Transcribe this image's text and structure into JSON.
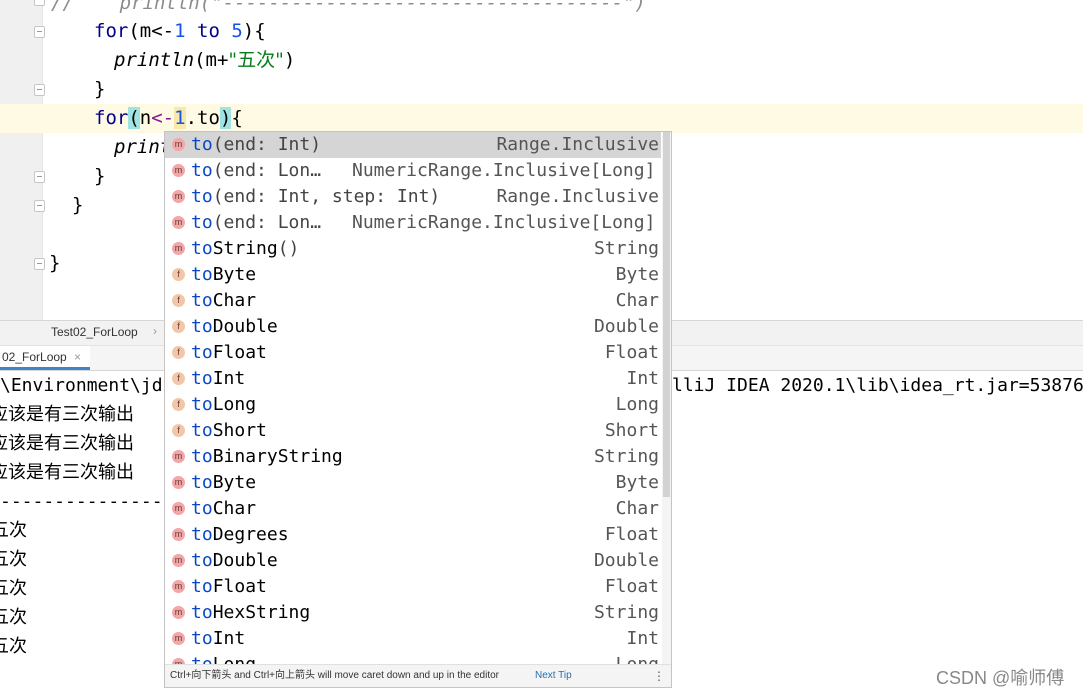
{
  "editor": {
    "comment_line": "//    println(\"-----------------------------------\")",
    "line2": {
      "kw": "for",
      "a": "(m<-",
      "n1": "1",
      "sp": " ",
      "kw2": "to",
      "n2": " 5",
      "b": "){"
    },
    "line3": {
      "fn": "println",
      "a": "(m+",
      "str": "\"五次\"",
      "b": ")"
    },
    "line4": "}",
    "line5": {
      "kw": "for",
      "paren": "(",
      "a": "n",
      "arrow": "<-",
      "n1": "1",
      "dot": ".to",
      "close": ")",
      "b": "{"
    },
    "line6_partial": "print",
    "line7": "}",
    "line8": "}",
    "line9": "}"
  },
  "tabs": {
    "file_tab": "Test02_ForLoop",
    "separator": "›",
    "run_tab": "02_ForLoop",
    "run_tab_close": "×"
  },
  "console": {
    "path_left": "\\Environment\\jd",
    "path_right": "lliJ IDEA 2020.1\\lib\\idea_rt.jar=53876",
    "lines": [
      "应该是有三次输出",
      "应该是有三次输出",
      "应该是有三次输出"
    ],
    "dashes": "-----------------",
    "five_lines": [
      "五次",
      "五次",
      "五次",
      "五次",
      "五次"
    ]
  },
  "completion": {
    "items": [
      {
        "kind": "m",
        "prefix": "to",
        "rest": "",
        "params": "(end: Int)",
        "mid": "",
        "type": "Range.Inclusive",
        "selected": true
      },
      {
        "kind": "m",
        "prefix": "to",
        "rest": "",
        "params": "(end: Lon…",
        "mid": "NumericRange.Inclusive[Long]",
        "type": "",
        "selected": false
      },
      {
        "kind": "m",
        "prefix": "to",
        "rest": "",
        "params": "(end: Int, step: Int)",
        "mid": "",
        "type": "Range.Inclusive",
        "selected": false
      },
      {
        "kind": "m",
        "prefix": "to",
        "rest": "",
        "params": "(end: Lon…",
        "mid": "NumericRange.Inclusive[Long]",
        "type": "",
        "selected": false
      },
      {
        "kind": "m",
        "prefix": "to",
        "rest": "String",
        "params": "()",
        "mid": "",
        "type": "String",
        "selected": false
      },
      {
        "kind": "f",
        "prefix": "to",
        "rest": "Byte",
        "params": "",
        "mid": "",
        "type": "Byte",
        "selected": false
      },
      {
        "kind": "f",
        "prefix": "to",
        "rest": "Char",
        "params": "",
        "mid": "",
        "type": "Char",
        "selected": false
      },
      {
        "kind": "f",
        "prefix": "to",
        "rest": "Double",
        "params": "",
        "mid": "",
        "type": "Double",
        "selected": false
      },
      {
        "kind": "f",
        "prefix": "to",
        "rest": "Float",
        "params": "",
        "mid": "",
        "type": "Float",
        "selected": false
      },
      {
        "kind": "f",
        "prefix": "to",
        "rest": "Int",
        "params": "",
        "mid": "",
        "type": "Int",
        "selected": false
      },
      {
        "kind": "f",
        "prefix": "to",
        "rest": "Long",
        "params": "",
        "mid": "",
        "type": "Long",
        "selected": false
      },
      {
        "kind": "f",
        "prefix": "to",
        "rest": "Short",
        "params": "",
        "mid": "",
        "type": "Short",
        "selected": false
      },
      {
        "kind": "m",
        "prefix": "to",
        "rest": "BinaryString",
        "params": "",
        "mid": "",
        "type": "String",
        "selected": false
      },
      {
        "kind": "m",
        "prefix": "to",
        "rest": "Byte",
        "params": "",
        "mid": "",
        "type": "Byte",
        "selected": false
      },
      {
        "kind": "m",
        "prefix": "to",
        "rest": "Char",
        "params": "",
        "mid": "",
        "type": "Char",
        "selected": false
      },
      {
        "kind": "m",
        "prefix": "to",
        "rest": "Degrees",
        "params": "",
        "mid": "",
        "type": "Float",
        "selected": false
      },
      {
        "kind": "m",
        "prefix": "to",
        "rest": "Double",
        "params": "",
        "mid": "",
        "type": "Double",
        "selected": false
      },
      {
        "kind": "m",
        "prefix": "to",
        "rest": "Float",
        "params": "",
        "mid": "",
        "type": "Float",
        "selected": false
      },
      {
        "kind": "m",
        "prefix": "to",
        "rest": "HexString",
        "params": "",
        "mid": "",
        "type": "String",
        "selected": false
      },
      {
        "kind": "m",
        "prefix": "to",
        "rest": "Int",
        "params": "",
        "mid": "",
        "type": "Int",
        "selected": false
      },
      {
        "kind": "m",
        "prefix": "to",
        "rest": "Long",
        "params": "",
        "mid": "",
        "type": "Long",
        "selected": false
      }
    ],
    "footer_hint": "Ctrl+向下箭头 and Ctrl+向上箭头 will move caret down and up in the editor",
    "footer_tip": "Next Tip",
    "footer_menu": "⋮"
  },
  "watermark": "CSDN @喻师傅"
}
